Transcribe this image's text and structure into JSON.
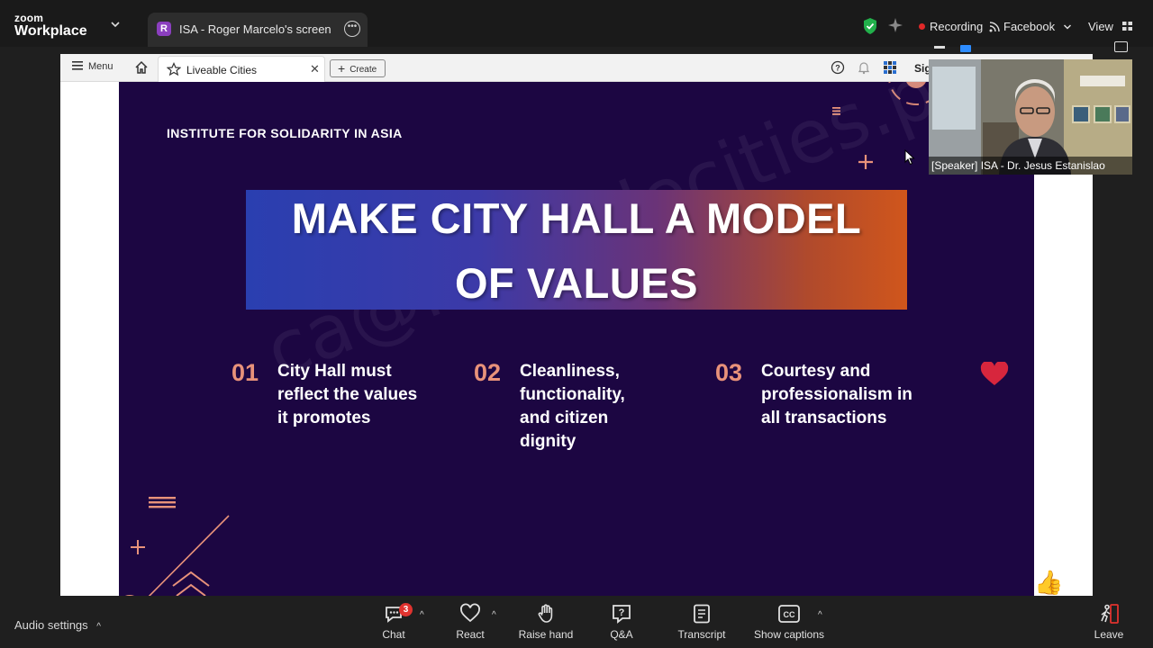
{
  "app": {
    "brand_top": "zoom",
    "brand_bottom": "Workplace"
  },
  "share_tab": {
    "badge": "R",
    "title": "ISA - Roger Marcelo's screen"
  },
  "status": {
    "recording": "Recording",
    "stream": "Facebook",
    "view": "View"
  },
  "browser": {
    "menu_label": "Menu",
    "tab_label": "Liveable Cities",
    "create_label": "Create",
    "sign_label": "Sig"
  },
  "slide": {
    "org": "INSTITUTE FOR SOLIDARITY IN ASIA",
    "headline_line1": "MAKE CITY HALL A MODEL",
    "headline_line2": "OF VALUES",
    "watermark": "ca@liveablecities.ph",
    "points": [
      {
        "num": "01",
        "text": "City Hall must reflect the values it promotes"
      },
      {
        "num": "02",
        "text": "Cleanliness, functionality, and citizen dignity"
      },
      {
        "num": "03",
        "text": "Courtesy and professionalism in all transactions"
      }
    ]
  },
  "video": {
    "label": "[Speaker] ISA - Dr. Jesus Estanislao"
  },
  "toolbar": {
    "audio_settings": "Audio settings",
    "chat": "Chat",
    "chat_count": "3",
    "react": "React",
    "raise_hand": "Raise hand",
    "qa": "Q&A",
    "transcript": "Transcript",
    "captions": "Show captions",
    "leave": "Leave"
  },
  "colors": {
    "slide_bg": "#1c0642",
    "accent_num": "#e8927a",
    "recording_dot": "#e02828",
    "leave_red": "#e0332f"
  }
}
